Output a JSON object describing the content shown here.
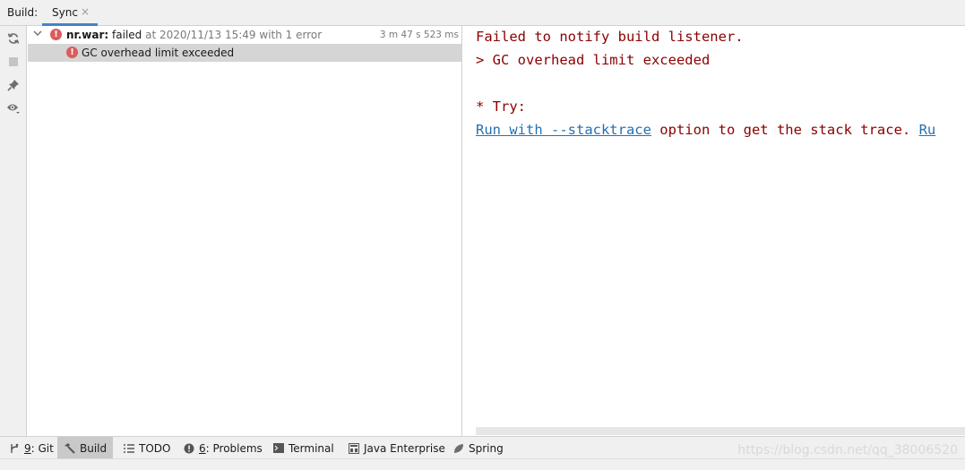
{
  "header": {
    "label": "Build:",
    "tab": {
      "label": "Sync",
      "close": "×"
    }
  },
  "toolbar": {
    "buttons": [
      "sync-icon",
      "stop-icon",
      "pin-icon",
      "eye-icon"
    ]
  },
  "tree": {
    "root": {
      "name": "nr.war:",
      "status": "failed",
      "detail": "at 2020/11/13 15:49 with 1 error",
      "duration": "3 m 47 s 523 ms"
    },
    "child": {
      "label": "GC overhead limit exceeded"
    }
  },
  "console": {
    "line1": "Failed to notify build listener.",
    "line2": "> GC overhead limit exceeded",
    "line3": "* Try:",
    "line4_link": "Run with --stacktrace",
    "line4_text": " option to get the stack trace. ",
    "line4_link2": "Ru"
  },
  "bottom_tabs": [
    {
      "num": "9",
      "label": ": Git",
      "icon": "git-icon"
    },
    {
      "num": "",
      "label": "Build",
      "icon": "hammer-icon"
    },
    {
      "num": "",
      "label": "TODO",
      "icon": "list-icon"
    },
    {
      "num": "6",
      "label": ": Problems",
      "icon": "problems-icon"
    },
    {
      "num": "",
      "label": "Terminal",
      "icon": "terminal-icon"
    },
    {
      "num": "",
      "label": "Java Enterprise",
      "icon": "java-enterprise-icon"
    },
    {
      "num": "",
      "label": "Spring",
      "icon": "spring-icon"
    }
  ],
  "watermark": "https://blog.csdn.net/qq_38006520",
  "colors": {
    "error": "#db5c5c",
    "console_error_text": "#8b0000",
    "link": "#2470b3",
    "tab_accent": "#4083c9"
  }
}
